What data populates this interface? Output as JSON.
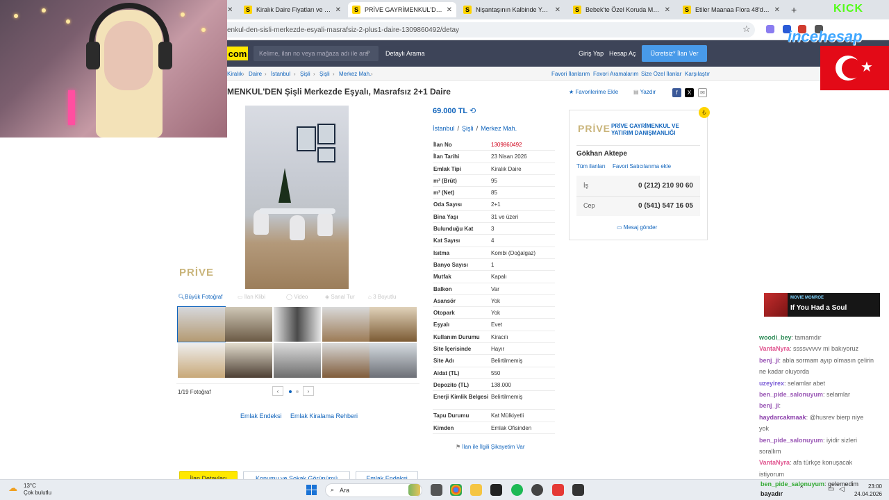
{
  "browser": {
    "tabs": [
      {
        "label": "Kiralık Daire Fiyatları ve Kiralık Ev",
        "active": false
      },
      {
        "label": "PRİVE GAYRİMENKUL'DEN Şişli",
        "active": true
      },
      {
        "label": "Nişantaşının Kalbinde Yeni Bina",
        "active": false
      },
      {
        "label": "Bebek'te Özel Koruda Muhteşem",
        "active": false
      },
      {
        "label": "Etiler Maanaa Flora 48'de Özel",
        "active": false
      }
    ],
    "favicon_letter": "S",
    "url": "enkul-den-sisli-merkezde-esyali-masrafsiz-2-plus1-daire-1309860492/detay"
  },
  "site": {
    "logo": "com",
    "search_placeholder": "Kelime, ilan no veya mağaza adı ile ara",
    "detailed_search": "Detaylı Arama",
    "login": "Giriş Yap",
    "register": "Hesap Aç",
    "post_ad": "Ücretsiz* İlan Ver",
    "breadcrumbs": [
      "Kiralık",
      "Daire",
      "İstanbul",
      "Şişli",
      "Şişli",
      "Merkez Mah."
    ],
    "top_links": [
      "Favori İlanlarım",
      "Favori Aramalarım",
      "Size Özel İlanlar",
      "Karşılaştır"
    ]
  },
  "listing": {
    "title": "MENKUL'DEN Şişli Merkezde Eşyalı, Masrafsız 2+1 Daire",
    "add_favorite": "Favorilerime Ekle",
    "print": "Yazdır",
    "price": "69.000 TL",
    "location": [
      "İstanbul",
      "Şişli",
      "Merkez Mah."
    ],
    "properties": [
      {
        "key": "İlan No",
        "value": "1309860492"
      },
      {
        "key": "İlan Tarihi",
        "value": "23 Nisan 2026"
      },
      {
        "key": "Emlak Tipi",
        "value": "Kiralık Daire"
      },
      {
        "key": "m² (Brüt)",
        "value": "95"
      },
      {
        "key": "m² (Net)",
        "value": "85"
      },
      {
        "key": "Oda Sayısı",
        "value": "2+1"
      },
      {
        "key": "Bina Yaşı",
        "value": "31 ve üzeri"
      },
      {
        "key": "Bulunduğu Kat",
        "value": "3"
      },
      {
        "key": "Kat Sayısı",
        "value": "4"
      },
      {
        "key": "Isıtma",
        "value": "Kombi (Doğalgaz)"
      },
      {
        "key": "Banyo Sayısı",
        "value": "1"
      },
      {
        "key": "Mutfak",
        "value": "Kapalı"
      },
      {
        "key": "Balkon",
        "value": "Var"
      },
      {
        "key": "Asansör",
        "value": "Yok"
      },
      {
        "key": "Otopark",
        "value": "Yok"
      },
      {
        "key": "Eşyalı",
        "value": "Evet"
      },
      {
        "key": "Kullanım Durumu",
        "value": "Kiracılı"
      },
      {
        "key": "Site İçerisinde",
        "value": "Hayır"
      },
      {
        "key": "Site Adı",
        "value": "Belirtilmemiş"
      },
      {
        "key": "Aidat (TL)",
        "value": "550"
      },
      {
        "key": "Depozito (TL)",
        "value": "138.000"
      },
      {
        "key": "Enerji Kimlik Belgesi",
        "value": "Belirtilmemiş"
      },
      {
        "key": "Tapu Durumu",
        "value": "Kat Mülkiyetli"
      },
      {
        "key": "Kimden",
        "value": "Emlak Ofisinden"
      }
    ],
    "complaint": "İlan ile İlgili Şikayetim Var"
  },
  "gallery": {
    "watermark": "PRİVE",
    "tabs": [
      "Büyük Fotoğraf",
      "İlan Klibi",
      "Video",
      "Sanal Tur",
      "3 Boyutlu"
    ],
    "count": "1/19 Fotoğraf",
    "links": [
      "Emlak Endeksi",
      "Emlak Kiralama Rehberi"
    ],
    "bottom_tabs": [
      "İlan Detayları",
      "Konumu ve Sokak Görünümü",
      "Emlak Endeksi"
    ]
  },
  "seller": {
    "logo": "PRİVE",
    "company": "PRİVE GAYRİMENKUL VE YATIRIM DANIŞMANLIĞI",
    "person": "Gökhan Aktepe",
    "all_listings": "Tüm ilanları",
    "add_favorite_seller": "Favori Satıcılarıma ekle",
    "phones": [
      {
        "label": "İş",
        "number": "0 (212) 210 90 60"
      },
      {
        "label": "Cep",
        "number": "0 (541) 547 16 05"
      }
    ],
    "send_message": "Mesaj gönder"
  },
  "overlay": {
    "kick": "KICK",
    "sponsor": "incehesap",
    "music_label": "MOVIE MONROE",
    "music_song": "If You Had a Soul",
    "chat": [
      {
        "user": "woodi_bey",
        "text": ": tamamdır"
      },
      {
        "user": "VantaNyra",
        "text": ": ssssvvvvv mi bakıyoruz"
      },
      {
        "user": "benj_ji",
        "text": ": abla sormam ayıp olmasın çelirin"
      },
      {
        "user": "",
        "text": "ne kadar oluyorda"
      },
      {
        "user": "uzeyirex",
        "text": ": selamlar abet"
      },
      {
        "user": "ben_pide_salonuyum",
        "text": ": selamlar"
      },
      {
        "user": "benj_ji",
        "text": ":"
      },
      {
        "user": "haydarcakmaak",
        "text": ": @husrev bierp niye"
      },
      {
        "user": "",
        "text": "yok"
      },
      {
        "user": "ben_pide_salonuyum",
        "text": ": iyidir sizleri"
      },
      {
        "user": "",
        "text": "sorallım"
      },
      {
        "user": "VantaNyra",
        "text": ": afa türkçe konuşacak"
      },
      {
        "user": "",
        "text": "istiyorum"
      }
    ],
    "ticker_user": "ben_pide_salonuyum",
    "ticker_text": ": gelemedim",
    "ticker_user2": "bayadır"
  },
  "taskbar": {
    "weather_temp": "13°C",
    "weather_desc": "Çok bulutlu",
    "search": "Ara",
    "time": "23:00",
    "date": "24.04.2026"
  }
}
